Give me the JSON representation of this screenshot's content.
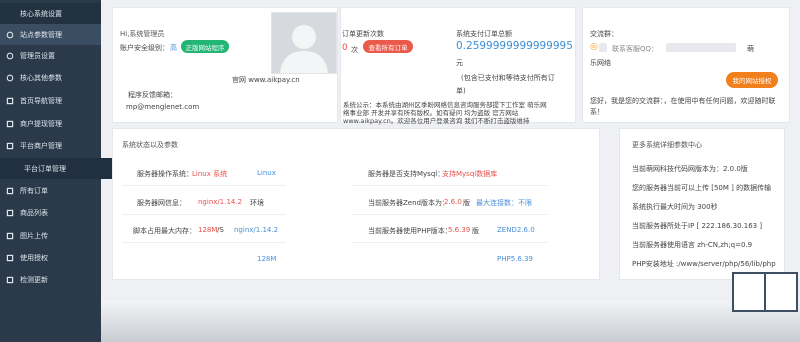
{
  "sidebar": {
    "items": [
      {
        "label": "核心系统设置",
        "icon": "cog-icon"
      },
      {
        "label": "站点参数管理",
        "icon": "circle-icon"
      },
      {
        "label": "管理员设置",
        "icon": "circle-icon"
      },
      {
        "label": "核心其他参数",
        "icon": "circle-icon"
      },
      {
        "label": "首页导航管理",
        "icon": "grid-icon"
      },
      {
        "label": "商户提现管理",
        "icon": "grid-icon"
      },
      {
        "label": "平台商户管理",
        "icon": "grid-icon"
      },
      {
        "label": "平台订单管理",
        "icon": "none"
      },
      {
        "label": "所有订单",
        "icon": "grid-icon"
      },
      {
        "label": "商品列表",
        "icon": "grid-icon"
      },
      {
        "label": "图片上传",
        "icon": "grid-icon"
      },
      {
        "label": "使用授权",
        "icon": "grid-icon"
      },
      {
        "label": "检测更新",
        "icon": "grid-icon"
      }
    ]
  },
  "admin": {
    "greeting": "Hi,系统管理员",
    "security_label": "账户安全级别：",
    "security_level": "高",
    "official_button": "正版网站程序",
    "website": "官网 www.aikpay.cn",
    "feedback_label": "程序反馈邮箱：",
    "feedback_email": "mp@menglenet.com"
  },
  "orders": {
    "update_count_label": "订单更新次数",
    "update_count_value": "0",
    "update_count_unit": "次",
    "view_all_button": "查看所有订单",
    "total_label": "系统支付订单总额",
    "total_value": "0.2599999999999995",
    "total_unit": "元",
    "note_line1": "(包含已支付和等待支付所有订",
    "note_line2": "单)",
    "announcement": [
      "系统公示：本系统由湖州区季盼网络信息咨询服务部提下工作室 萌乐网",
      "络事业部 开发并享有所有版权。如有疑问 均为盗版 官方网站",
      "www.aikpay.cn。欢迎各位用户登录咨询 我们不断打击盗版维持"
    ]
  },
  "contact": {
    "title": "交流群：",
    "support_label": "联系客服QQ：",
    "company_line1": "萌",
    "company_line2": "乐网络",
    "auth_button": "我的网站授权",
    "welcome_line1": "您好，我是您的交流群：，在使用中有任何问题，欢迎随时联",
    "welcome_line2": "系！"
  },
  "status": {
    "title": "系统状态以及参数",
    "left_rows": [
      {
        "label": "服务器操作系统：",
        "value": "Linux 系统",
        "extra": "Linux"
      },
      {
        "label": "服务器网信息：",
        "value": "nginx/1.14.2",
        "value2": "环境",
        "extra": ""
      },
      {
        "label": "脚本占用最大内存：",
        "value": "128M",
        "value2": "/S",
        "extra": "nginx/1.14.2"
      },
      {
        "label": "",
        "value": "",
        "extra": "128M"
      }
    ],
    "right_rows": [
      {
        "label": "服务器是否支持Mysql：",
        "value": "支持Mysql数据库",
        "extra": ""
      },
      {
        "label": "当前服务器Zend版本为：",
        "value": "2.6.0",
        "value2": "版",
        "extra": "最大连接数：不限"
      },
      {
        "label": "当前服务器使用PHP版本：",
        "value": "5.6.39",
        "value2": "版",
        "extra": "ZEND2.6.0"
      },
      {
        "label": "",
        "value": "",
        "extra": "PHP5.6.39"
      }
    ]
  },
  "details": {
    "title": "更多系统详细参数中心",
    "lines": [
      "当前萌网科技代码网版本为：2.0.0版",
      "您的服务器当前可以上传 [50M ] 的数据传输",
      "系统执行最大时间为 300秒",
      "当前服务器所处于IP [ 222.186.30.163 ]",
      "当前服务器使用语言 zh-CN,zh;q=0.9",
      "PHP安装地址 :/www/server/php/56/lib/php"
    ]
  },
  "colors": {
    "sidebar": "#2b3a4a",
    "green": "#22b573",
    "red": "#ea5a4b",
    "orange": "#f07f1c",
    "link": "#4a90d9",
    "total": "#3b8fd6"
  }
}
